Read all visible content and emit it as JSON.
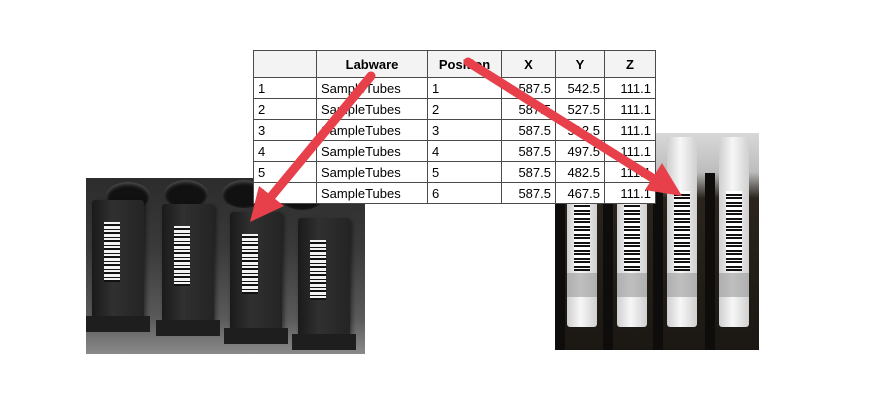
{
  "table": {
    "headers": [
      "",
      "Labware",
      "Position",
      "X",
      "Y",
      "Z"
    ],
    "rows": [
      [
        "1",
        "SampleTubes",
        "1",
        "587.5",
        "542.5",
        "111.1"
      ],
      [
        "2",
        "SampleTubes",
        "2",
        "587.5",
        "527.5",
        "111.1"
      ],
      [
        "3",
        "SampleTubes",
        "3",
        "587.5",
        "512.5",
        "111.1"
      ],
      [
        "4",
        "SampleTubes",
        "4",
        "587.5",
        "497.5",
        "111.1"
      ],
      [
        "5",
        "SampleTubes",
        "5",
        "587.5",
        "482.5",
        "111.1"
      ],
      [
        "6",
        "SampleTubes",
        "6",
        "587.5",
        "467.5",
        "111.1"
      ]
    ]
  },
  "colors": {
    "arrow": "#e8404a",
    "grid": "#4a4a4a",
    "header_bg": "#f3f3f3"
  },
  "icons": {
    "arrow_to_rack": "arrow-right-down-icon",
    "arrow_to_tubes": "arrow-left-down-icon"
  }
}
